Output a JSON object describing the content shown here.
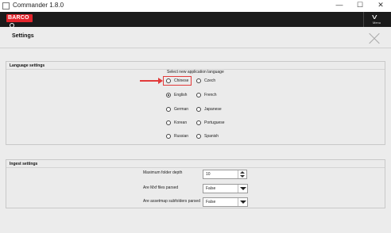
{
  "window": {
    "title": "Commander 1.8.0",
    "controls": {
      "minimize": "—",
      "maximize": "☐",
      "close": "✕"
    }
  },
  "topbar": {
    "brand": "BARCO",
    "menu_label": "Menu",
    "menu_icon": "chevron-down"
  },
  "page": {
    "title": "Settings"
  },
  "language_settings": {
    "title": "Language settings",
    "caption": "Select new application language",
    "selected": "English",
    "highlighted": "Chinese",
    "left_column": [
      "Chinese",
      "English",
      "German",
      "Korean",
      "Russian"
    ],
    "right_column": [
      "Czech",
      "French",
      "Japanese",
      "Portuguese",
      "Spanish"
    ]
  },
  "ingest_settings": {
    "title": "Ingest settings",
    "fields": [
      {
        "label": "Maximum folder depth",
        "value": "10",
        "control": "spinner"
      },
      {
        "label": "Are Mxf files parsed",
        "value": "False",
        "control": "dropdown"
      },
      {
        "label": "Are assetmap subfolders parsed",
        "value": "False",
        "control": "dropdown"
      }
    ]
  },
  "colors": {
    "accent": "#e3252c",
    "topbar": "#1b1b1b",
    "annotation": "#e23a3a"
  }
}
